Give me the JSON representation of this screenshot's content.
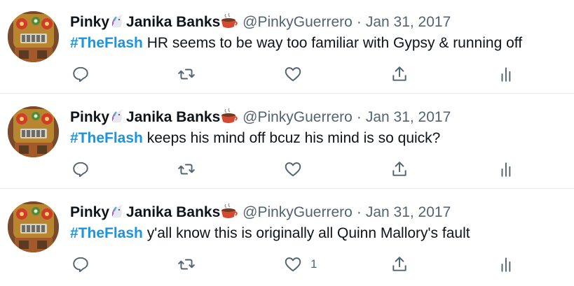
{
  "tweets": [
    {
      "display_name_pre": "Pinky",
      "display_name_post": "Janika Banks",
      "handle": "@PinkyGuerrero",
      "separator": "·",
      "date": "Jan 31, 2017",
      "hashtag": "#TheFlash",
      "text": " HR seems to be way too familiar with Gypsy & running off",
      "like_count": ""
    },
    {
      "display_name_pre": "Pinky",
      "display_name_post": "Janika Banks",
      "handle": "@PinkyGuerrero",
      "separator": "·",
      "date": "Jan 31, 2017",
      "hashtag": "#TheFlash",
      "text": " keeps his mind off bcuz his mind is so quick?",
      "like_count": ""
    },
    {
      "display_name_pre": "Pinky",
      "display_name_post": "Janika Banks",
      "handle": "@PinkyGuerrero",
      "separator": "·",
      "date": "Jan 31, 2017",
      "hashtag": "#TheFlash",
      "text": " y'all know this is originally all Quinn Mallory's fault",
      "like_count": "1"
    }
  ],
  "icons": {
    "name_emoji_1": "unicorn-icon",
    "name_emoji_2": "hot-beverage-icon",
    "reply": "reply-icon",
    "retweet": "retweet-icon",
    "like": "heart-icon",
    "share": "share-icon",
    "analytics": "analytics-icon"
  },
  "colors": {
    "hashtag": "#1b95e0",
    "secondary_text": "#536471",
    "divider": "#e6ecf0"
  }
}
